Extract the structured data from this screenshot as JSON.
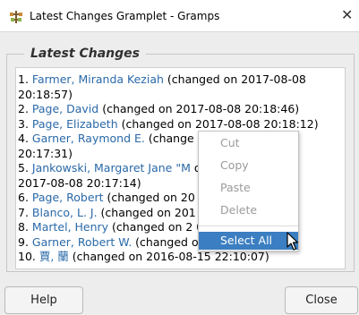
{
  "window": {
    "title": "Latest Changes Gramplet - Gramps",
    "app_icon": "gramps-tree-icon",
    "close_icon": "close-icon"
  },
  "frame": {
    "legend": "Latest Changes"
  },
  "text_lines": [
    {
      "parts": [
        {
          "t": "1. "
        },
        {
          "t": "Farmer, Miranda Keziah",
          "link": true
        },
        {
          "t": " (changed on 2017-08-08"
        }
      ]
    },
    {
      "parts": [
        {
          "t": "20:18:57)"
        }
      ]
    },
    {
      "parts": [
        {
          "t": "2. "
        },
        {
          "t": "Page, David",
          "link": true
        },
        {
          "t": " (changed on 2017-08-08 20:18:46)"
        }
      ]
    },
    {
      "parts": [
        {
          "t": "3. "
        },
        {
          "t": "Page, Elizabeth",
          "link": true
        },
        {
          "t": " (changed on 2017-08-08 20:18:12)"
        }
      ]
    },
    {
      "parts": [
        {
          "t": "4. "
        },
        {
          "t": "Garner, Raymond E.",
          "link": true
        },
        {
          "t": " (change"
        }
      ]
    },
    {
      "parts": [
        {
          "t": "20:17:31)"
        }
      ]
    },
    {
      "parts": [
        {
          "t": "5. "
        },
        {
          "t": "Jankowski, Margaret Jane \"M",
          "link": true
        },
        {
          "t": "                  on"
        }
      ]
    },
    {
      "parts": [
        {
          "t": "2017-08-08 20:17:14)"
        }
      ]
    },
    {
      "parts": [
        {
          "t": "6. "
        },
        {
          "t": "Page, Robert",
          "link": true
        },
        {
          "t": " (changed on 20             7)"
        }
      ]
    },
    {
      "parts": [
        {
          "t": "7. "
        },
        {
          "t": "Blanco, L. J.",
          "link": true
        },
        {
          "t": " (changed on 201             09)"
        }
      ]
    },
    {
      "parts": [
        {
          "t": "8. "
        },
        {
          "t": "Martel, Henry",
          "link": true
        },
        {
          "t": " (changed on 2             08)"
        }
      ]
    },
    {
      "parts": [
        {
          "t": "9. "
        },
        {
          "t": "Garner, Robert W.",
          "link": true
        },
        {
          "t": " (changed o             14:20)"
        }
      ]
    },
    {
      "parts": [
        {
          "t": "10. "
        },
        {
          "t": "賈, 蘭",
          "link": true
        },
        {
          "t": " (changed on 2016-08-15 22:10:07)"
        }
      ]
    }
  ],
  "context_menu": {
    "items": [
      {
        "name": "menu-item-cut",
        "label": "Cut",
        "enabled": false
      },
      {
        "name": "menu-item-copy",
        "label": "Copy",
        "enabled": false
      },
      {
        "name": "menu-item-paste",
        "label": "Paste",
        "enabled": false
      },
      {
        "name": "menu-item-delete",
        "label": "Delete",
        "enabled": false
      },
      {
        "name": "menu-item-select-all",
        "label": "Select All",
        "enabled": true,
        "highlighted": true
      }
    ]
  },
  "buttons": {
    "help": "Help",
    "close": "Close"
  },
  "colors": {
    "link": "#2a69a8",
    "menu_highlight": "#3b7ec1",
    "disabled_text": "#9b9b9b"
  }
}
